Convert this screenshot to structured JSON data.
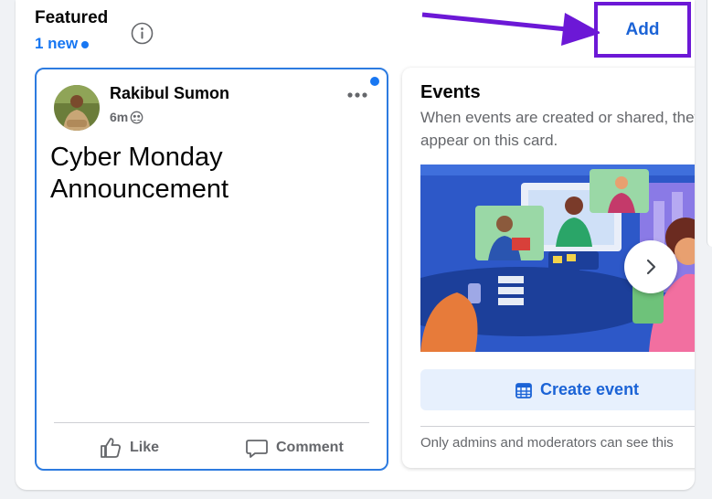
{
  "featured": {
    "title": "Featured",
    "new_count": "1 new"
  },
  "add_button": {
    "label": "Add"
  },
  "post": {
    "author": "Rakibul Sumon",
    "time": "6m",
    "text": "Cyber Monday Announcement",
    "like_label": "Like",
    "comment_label": "Comment"
  },
  "events": {
    "title": "Events",
    "description": "When events are created or shared, they appear on this card.",
    "create_label": "Create event",
    "note": "Only admins and moderators can see this"
  },
  "icons": {
    "info": "info-icon",
    "more": "more-options-icon",
    "audience": "group-audience-icon",
    "like": "thumbs-up-icon",
    "comment": "comment-icon",
    "calendar": "calendar-icon",
    "next": "chevron-right-icon"
  },
  "colors": {
    "accent": "#1877f2",
    "annotation": "#6c18d6",
    "text_secondary": "#65676b"
  }
}
